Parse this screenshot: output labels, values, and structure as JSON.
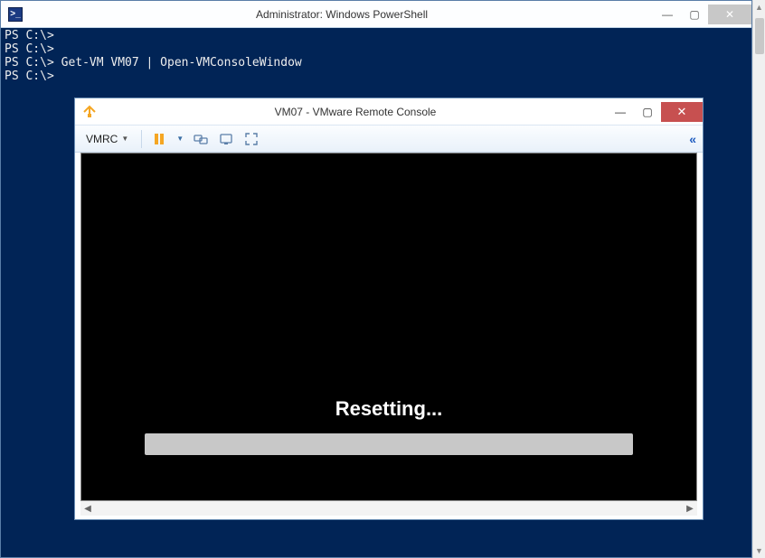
{
  "powershell": {
    "title": "Administrator: Windows PowerShell",
    "lines": [
      "PS C:\\>",
      "PS C:\\>",
      "PS C:\\> Get-VM VM07 | Open-VMConsoleWindow",
      "PS C:\\>"
    ]
  },
  "vmrc": {
    "title": "VM07 - VMware Remote Console",
    "menu_label": "VMRC",
    "status_text": "Resetting...",
    "icons": {
      "pause": "pause-icon",
      "connect": "connect-devices-icon",
      "send_cad": "send-ctrl-alt-del-icon",
      "fullscreen": "fullscreen-icon"
    }
  },
  "window_controls": {
    "minimize": "—",
    "maximize": "▢",
    "close": "✕"
  }
}
